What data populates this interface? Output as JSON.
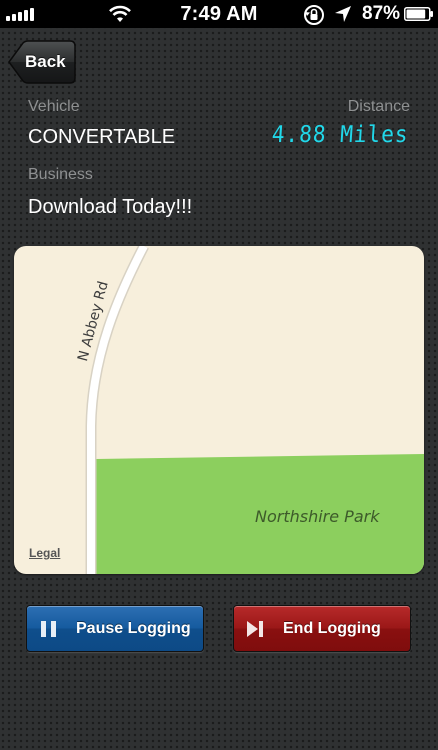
{
  "status_bar": {
    "time": "7:49 AM",
    "battery_percent": "87%",
    "battery_level": 0.87
  },
  "nav": {
    "back_label": "Back"
  },
  "info": {
    "vehicle_label": "Vehicle",
    "vehicle_value": "CONVERTABLE",
    "distance_label": "Distance",
    "distance_value": "4.88 Miles",
    "business_label": "Business",
    "business_value": "Download Today!!!"
  },
  "map": {
    "road_name": "N Abbey Rd",
    "park_name": "Northshire Park",
    "legal_label": "Legal",
    "colors": {
      "land": "#f7efdc",
      "park": "#8ccf5e",
      "road": "#ffffff"
    }
  },
  "actions": {
    "pause_label": "Pause Logging",
    "end_label": "End Logging",
    "colors": {
      "pause": "#155a9e",
      "end": "#9a1717"
    }
  },
  "icons": {
    "signal": "signal-icon",
    "wifi": "wifi-icon",
    "rotation_lock": "rotation-lock-icon",
    "location": "location-arrow-icon",
    "battery": "battery-icon",
    "pause": "pause-icon",
    "end": "skip-end-icon"
  }
}
